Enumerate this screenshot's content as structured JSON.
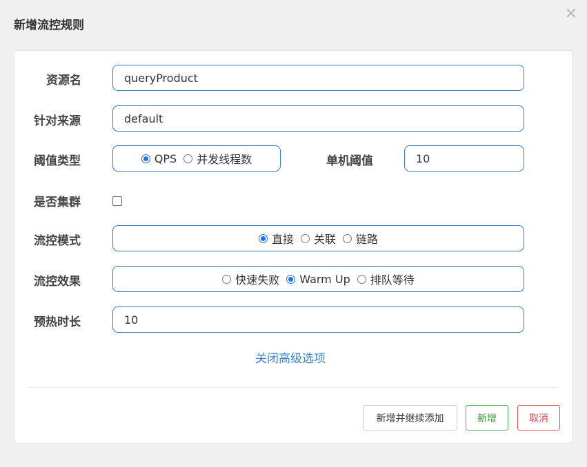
{
  "dialog": {
    "title": "新增流控规则",
    "close_glyph": "×"
  },
  "form": {
    "resource": {
      "label": "资源名",
      "value": "queryProduct"
    },
    "limit_app": {
      "label": "针对来源",
      "value": "default"
    },
    "grade": {
      "label": "阈值类型",
      "options": [
        {
          "label": "QPS",
          "checked": true
        },
        {
          "label": "并发线程数",
          "checked": false
        }
      ]
    },
    "threshold": {
      "label": "单机阈值",
      "value": "10"
    },
    "cluster": {
      "label": "是否集群",
      "checked": false
    },
    "strategy": {
      "label": "流控模式",
      "options": [
        {
          "label": "直接",
          "checked": true
        },
        {
          "label": "关联",
          "checked": false
        },
        {
          "label": "链路",
          "checked": false
        }
      ]
    },
    "control_behavior": {
      "label": "流控效果",
      "options": [
        {
          "label": "快速失败",
          "checked": false
        },
        {
          "label": "Warm Up",
          "checked": true
        },
        {
          "label": "排队等待",
          "checked": false
        }
      ]
    },
    "warmup_period": {
      "label": "预热时长",
      "value": "10"
    },
    "advanced_toggle": "关闭高级选项"
  },
  "footer": {
    "add_continue": "新增并继续添加",
    "add": "新增",
    "cancel": "取消"
  },
  "colors": {
    "accent": "#337ab7",
    "radio": "#1a73e8",
    "success": "#4cae4c",
    "danger": "#d9534f",
    "link": "#3a85c8"
  }
}
